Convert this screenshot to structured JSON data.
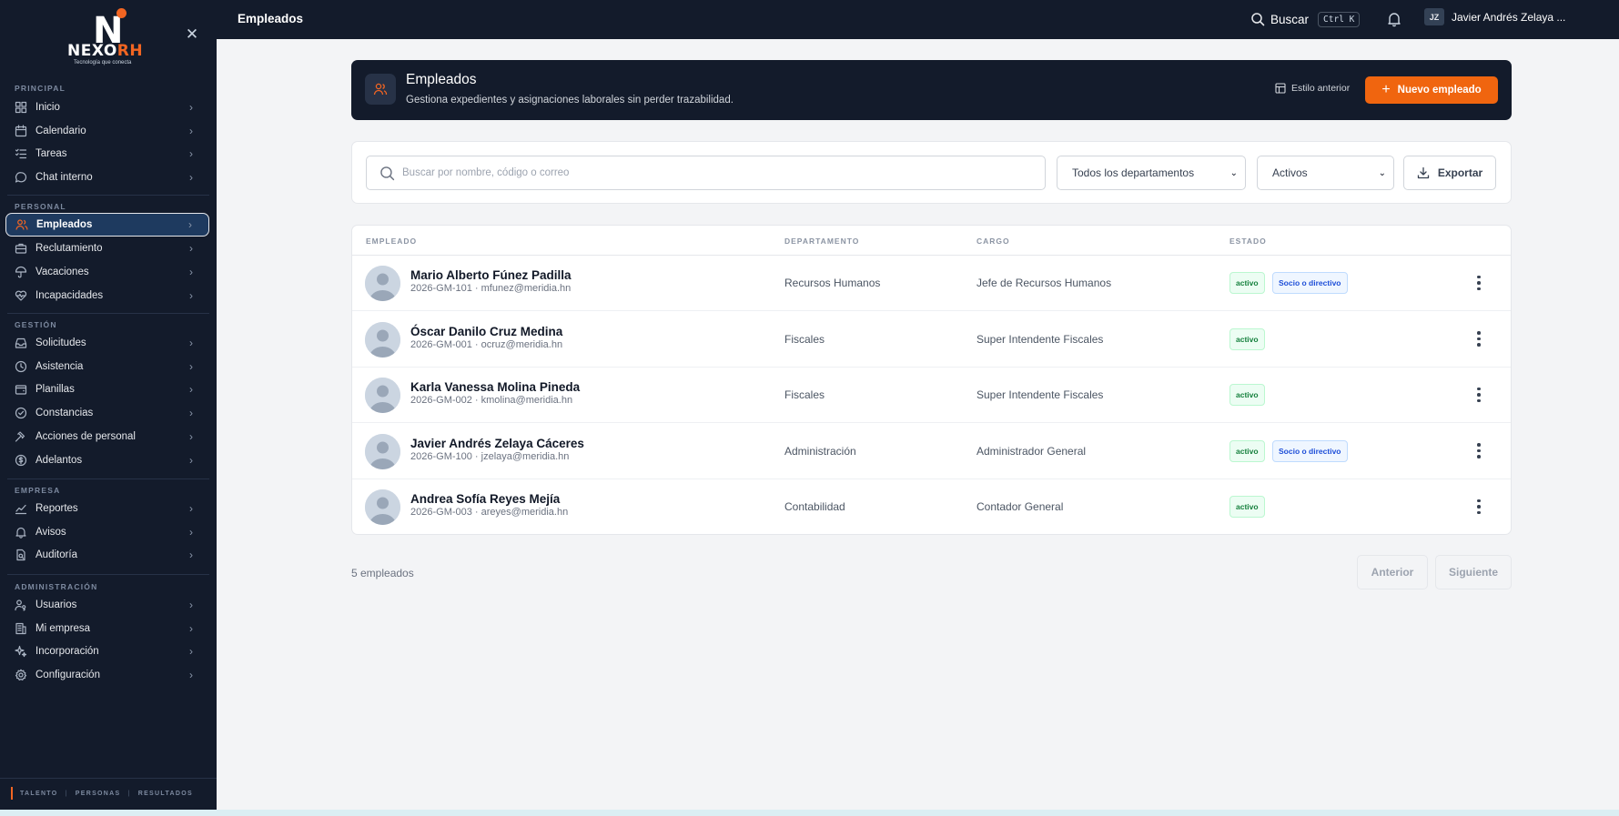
{
  "brand": {
    "wordmark_main": "NEXO",
    "wordmark_accent": "RH",
    "tagline": "Tecnología que conecta",
    "accent_color": "#f26522"
  },
  "sidebar": {
    "sections": [
      {
        "title": "PRINCIPAL",
        "items": [
          {
            "label": "Inicio",
            "icon": "dashboard-icon"
          },
          {
            "label": "Calendario",
            "icon": "calendar-icon"
          },
          {
            "label": "Tareas",
            "icon": "tasks-icon"
          },
          {
            "label": "Chat interno",
            "icon": "chat-icon"
          }
        ]
      },
      {
        "title": "PERSONAL",
        "items": [
          {
            "label": "Empleados",
            "icon": "users-icon",
            "active": true
          },
          {
            "label": "Reclutamiento",
            "icon": "briefcase-icon"
          },
          {
            "label": "Vacaciones",
            "icon": "umbrella-icon"
          },
          {
            "label": "Incapacidades",
            "icon": "heart-pulse-icon"
          }
        ]
      },
      {
        "title": "GESTIÓN",
        "items": [
          {
            "label": "Solicitudes",
            "icon": "inbox-icon"
          },
          {
            "label": "Asistencia",
            "icon": "clock-icon"
          },
          {
            "label": "Planillas",
            "icon": "wallet-icon"
          },
          {
            "label": "Constancias",
            "icon": "check-circle-icon"
          },
          {
            "label": "Acciones de personal",
            "icon": "gavel-icon"
          },
          {
            "label": "Adelantos",
            "icon": "dollar-circle-icon"
          }
        ]
      },
      {
        "title": "EMPRESA",
        "items": [
          {
            "label": "Reportes",
            "icon": "chart-icon"
          },
          {
            "label": "Avisos",
            "icon": "bell-icon"
          },
          {
            "label": "Auditoría",
            "icon": "audit-icon"
          }
        ]
      },
      {
        "title": "ADMINISTRACIÓN",
        "items": [
          {
            "label": "Usuarios",
            "icon": "user-key-icon"
          },
          {
            "label": "Mi empresa",
            "icon": "building-icon"
          },
          {
            "label": "Incorporación",
            "icon": "sparkles-icon"
          },
          {
            "label": "Configuración",
            "icon": "gear-icon"
          }
        ]
      }
    ],
    "footer": [
      "TALENTO",
      "PERSONAS",
      "RESULTADOS"
    ]
  },
  "topbar": {
    "title": "Empleados",
    "search_label": "Buscar",
    "shortcut": "Ctrl K",
    "user_initials": "JZ",
    "user_name": "Javier Andrés Zelaya ..."
  },
  "hero": {
    "title": "Empleados",
    "subtitle": "Gestiona expedientes y asignaciones laborales sin perder trazabilidad.",
    "old_style_label": "Estilo anterior",
    "new_button_label": "Nuevo empleado"
  },
  "filters": {
    "search_placeholder": "Buscar por nombre, código o correo",
    "department_value": "Todos los departamentos",
    "status_value": "Activos",
    "export_label": "Exportar"
  },
  "table": {
    "columns": [
      "EMPLEADO",
      "DEPARTAMENTO",
      "CARGO",
      "ESTADO"
    ],
    "rows": [
      {
        "name": "Mario Alberto Fúnez Padilla",
        "sub": "2026-GM-101 · mfunez@meridia.hn",
        "department": "Recursos Humanos",
        "position": "Jefe de Recursos Humanos",
        "status": "activo",
        "tag": "Socio o directivo"
      },
      {
        "name": "Óscar Danilo Cruz Medina",
        "sub": "2026-GM-001 · ocruz@meridia.hn",
        "department": "Fiscales",
        "position": "Super Intendente Fiscales",
        "status": "activo",
        "tag": ""
      },
      {
        "name": "Karla Vanessa Molina Pineda",
        "sub": "2026-GM-002 · kmolina@meridia.hn",
        "department": "Fiscales",
        "position": "Super Intendente Fiscales",
        "status": "activo",
        "tag": ""
      },
      {
        "name": "Javier Andrés Zelaya Cáceres",
        "sub": "2026-GM-100 · jzelaya@meridia.hn",
        "department": "Administración",
        "position": "Administrador General",
        "status": "activo",
        "tag": "Socio o directivo"
      },
      {
        "name": "Andrea Sofía Reyes Mejía",
        "sub": "2026-GM-003 · areyes@meridia.hn",
        "department": "Contabilidad",
        "position": "Contador General",
        "status": "activo",
        "tag": ""
      }
    ]
  },
  "pagination": {
    "count_label": "5 empleados",
    "prev_label": "Anterior",
    "next_label": "Siguiente"
  }
}
